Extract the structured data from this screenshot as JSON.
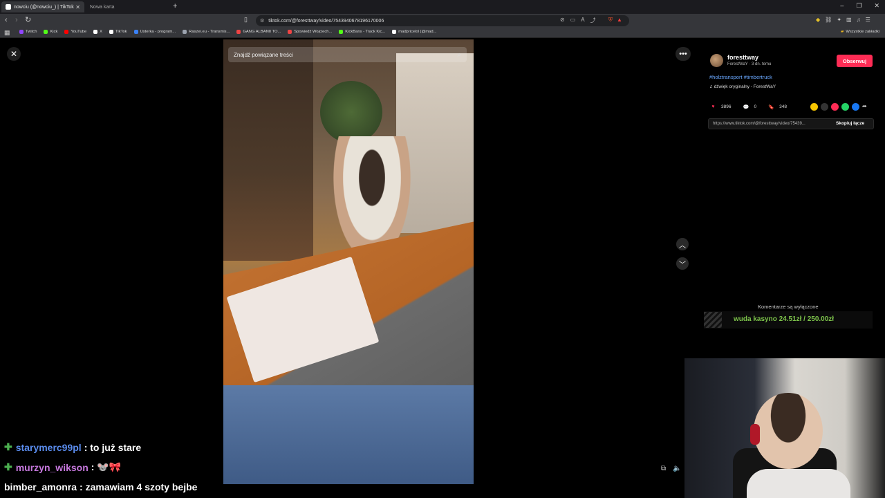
{
  "browser": {
    "tabs": [
      {
        "title": "nowciu (@nowciu_) | TikTok",
        "active": true
      },
      {
        "title": "Nowa karta",
        "active": false
      }
    ],
    "url": "tiktok.com/@foresttway/video/7543940678196170006",
    "bookmarks": [
      {
        "label": "Twitch",
        "color": "#9146ff"
      },
      {
        "label": "Kick",
        "color": "#53fc18"
      },
      {
        "label": "YouTube",
        "color": "#ff0000"
      },
      {
        "label": "X",
        "color": "#ffffff"
      },
      {
        "label": "TikTok",
        "color": "#ffffff"
      },
      {
        "label": "Usterka - program...",
        "color": "#3b82f6"
      },
      {
        "label": "Raszei.eu - Transmis...",
        "color": "#9ca3af"
      },
      {
        "label": "GANG ALBANII TO...",
        "color": "#ef4444"
      },
      {
        "label": "Spowiedź Wojciech...",
        "color": "#ef4444"
      },
      {
        "label": "KickBans - Track Kic...",
        "color": "#53fc18"
      },
      {
        "label": "madpricelol (@mad...",
        "color": "#ffffff"
      }
    ],
    "all_bookmarks": "Wszystkie zakładki"
  },
  "video": {
    "search_placeholder": "Znajdź powiązane treści"
  },
  "panel": {
    "author": "foresttway",
    "author_sub": "ForestWaY · 3 dn. temu",
    "follow_label": "Obserwuj",
    "hashtags": "#holztransport #timbertruck",
    "sound": "dźwięk oryginalny - ForestWaY",
    "likes": "3896",
    "comments": "0",
    "saves": "348",
    "link": "https://www.tiktok.com/@foresttway/video/75439...",
    "copy_link_label": "Skopiuj łącze",
    "comments_off": "Komentarze są wyłączone"
  },
  "overlay": {
    "casino": "wuda kasyno 24.51zł / 250.00zł",
    "chat": [
      {
        "user": "starymerc99pl",
        "user_color": "#5b8def",
        "message": ": to już stare",
        "badge": true
      },
      {
        "user": "murzyn_wikson",
        "user_color": "#c678dd",
        "message": ": 🐭🎀",
        "badge": true
      },
      {
        "user": "bimber_amonra",
        "user_color": "#ffffff",
        "message": ": zamawiam 4 szoty bejbe",
        "badge": false
      }
    ]
  }
}
